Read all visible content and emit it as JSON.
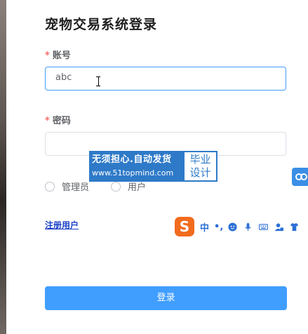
{
  "page": {
    "title": "宠物交易系统登录"
  },
  "form": {
    "account": {
      "required_mark": "*",
      "label": "账号",
      "value": "abc"
    },
    "password": {
      "required_mark": "*",
      "label": "密码",
      "value": ""
    },
    "roles": [
      {
        "label": "管理员",
        "selected": false
      },
      {
        "label": "用户",
        "selected": false
      }
    ],
    "register_link": "注册用户",
    "login_button": "登录"
  },
  "watermark": {
    "line1": "无须担心.自动发货",
    "line2": "www.51topmind.com",
    "badge_line1": "毕业",
    "badge_line2": "设计"
  },
  "ime_toolbar": {
    "logo": "S",
    "mode": "中",
    "punct": "•,",
    "icons": [
      "emoji-icon",
      "microphone-icon",
      "keyboard-icon",
      "user-icon",
      "shirt-icon"
    ]
  },
  "colors": {
    "primary": "#409eff",
    "required": "#f56c6c",
    "link": "#1a3fc7",
    "watermark": "#2e7ac8",
    "ime_logo": "#f26b1d"
  }
}
